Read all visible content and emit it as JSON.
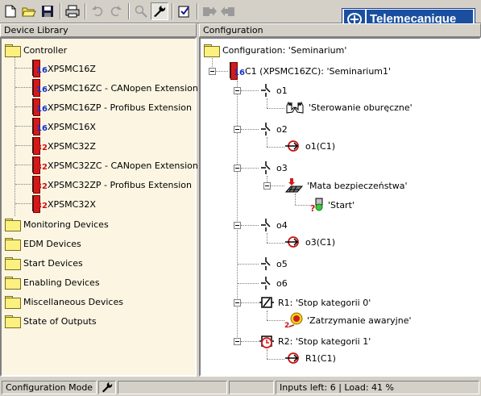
{
  "brand": {
    "name": "Telemecanique"
  },
  "left_panel": {
    "title": "Device Library",
    "controller_label": "Controller",
    "devices": [
      {
        "name": "XPSMC16Z",
        "badge": "16"
      },
      {
        "name": "XPSMC16ZC - CANopen Extension",
        "badge": "16"
      },
      {
        "name": "XPSMC16ZP - Profibus Extension",
        "badge": "16"
      },
      {
        "name": "XPSMC16X",
        "badge": "16"
      },
      {
        "name": "XPSMC32Z",
        "badge": "32"
      },
      {
        "name": "XPSMC32ZC - CANopen Extension",
        "badge": "32"
      },
      {
        "name": "XPSMC32ZP - Profibus Extension",
        "badge": "32"
      },
      {
        "name": "XPSMC32X",
        "badge": "32"
      }
    ],
    "categories": [
      "Monitoring Devices",
      "EDM Devices",
      "Start Devices",
      "Enabling Devices",
      "Miscellaneous Devices",
      "State of Outputs"
    ]
  },
  "right_panel": {
    "title": "Configuration",
    "root": "Configuration: 'Seminarium'",
    "controller": "C1 (XPSMC16ZC): 'Seminarium1'",
    "controller_badge": "16",
    "outputs": {
      "o1": "o1",
      "o1_child": "'Sterowanie oburęczne'",
      "o2": "o2",
      "o2_child": "o1(C1)",
      "o3": "o3",
      "o3_child": "'Mata bezpieczeństwa'",
      "o3_grandchild": "'Start'",
      "o4": "o4",
      "o4_child": "o3(C1)",
      "o5": "o5",
      "o6": "o6",
      "r1": "R1: 'Stop kategorii 0'",
      "r1_child": "'Zatrzymanie awaryjne'",
      "r1_child_mark": "2",
      "r2": "R2: 'Stop kategorii 1'",
      "r2_child": "R1(C1)"
    }
  },
  "statusbar": {
    "mode": "Configuration Mode",
    "inputs_load": "Inputs left: 6 | Load: 41 %"
  }
}
